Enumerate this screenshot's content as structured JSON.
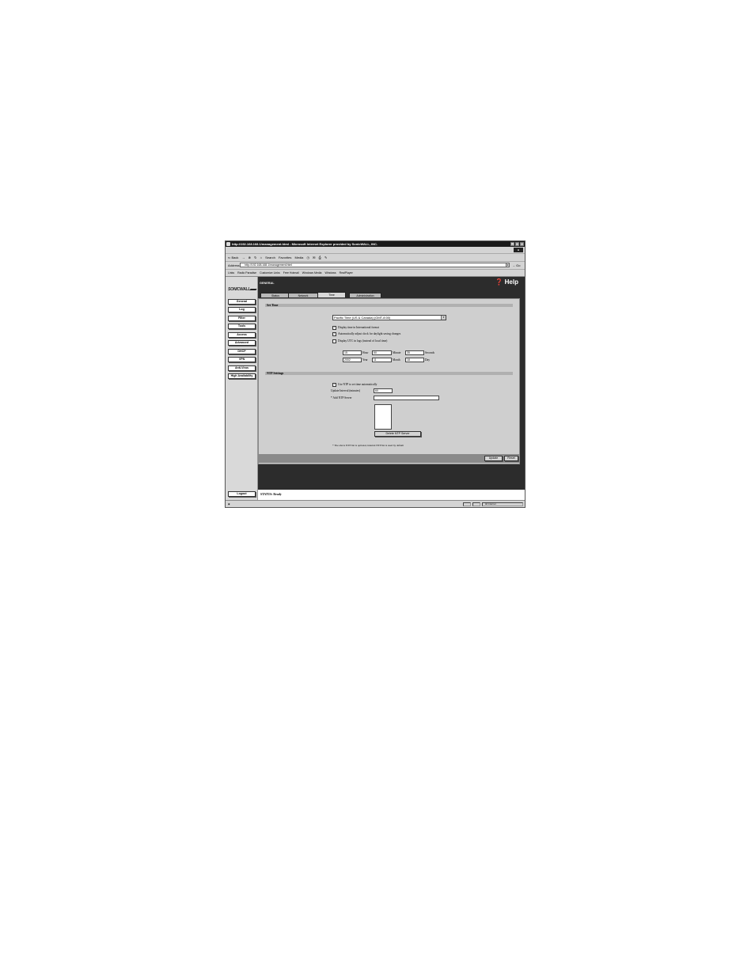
{
  "window": {
    "title": "http://192.168.168.1/management.html - Microsoft Internet Explorer provided by SonicWALL, INC."
  },
  "menu": [
    "File",
    "Edit",
    "View",
    "Favorites",
    "Tools",
    "Help"
  ],
  "toolbar": {
    "back": "⇐ Back",
    "forward": "→",
    "search": "Search",
    "favorites": "Favorites",
    "media": "Media"
  },
  "address": {
    "label": "Address",
    "url": "http://192.168.168.1/management.html",
    "go": "Go"
  },
  "links": {
    "label": "Links",
    "items": [
      "Radio Paradise",
      "Customize Links",
      "Free Hotmail",
      "Windows Media",
      "Windows",
      "RealPlayer"
    ]
  },
  "nav": {
    "brand": "SONICWALL",
    "items": [
      "General",
      "Log",
      "Filter",
      "Tools",
      "Access",
      "Advanced",
      "DHCP",
      "VPN",
      "Anti-Virus",
      "High Availability"
    ],
    "logout": "Logout"
  },
  "page": {
    "header": "GENERAL",
    "help": "Help",
    "tabs": [
      "Status",
      "Network",
      "Time",
      "Administration"
    ],
    "active_tab": "Time"
  },
  "set_time": {
    "title": "Set Time",
    "timezone": "Pacific Time (US & Canada) (GMT-8:00)",
    "opt_international": "Display time in International format",
    "opt_daylight": "Automatically adjust clock for daylight saving changes",
    "opt_utc": "Display UTC in logs (instead of local time)",
    "hour": "15",
    "hour_label": "Hour",
    "minute": "50",
    "minute_label": "Minute",
    "second": "35",
    "second_label": "Seconds",
    "year": "2002",
    "year_label": "Year",
    "month": "11",
    "month_label": "Month",
    "day": "18",
    "day_label": "Day"
  },
  "ntp": {
    "title": "NTP Settings",
    "opt_use_ntp": "Use NTP to set time automatically",
    "interval_label": "Update Interval (minutes)",
    "interval": "60",
    "add_label": "* Add NTP Server",
    "add_value": "",
    "delete_button": "Delete NTP Server",
    "note": "* The above NTP list is optional, internal NTP list is used by default"
  },
  "actions": {
    "update": "Update",
    "reset": "Reset"
  },
  "status": {
    "text": "STATUS: Ready"
  },
  "statusbar": {
    "zone": "Internet"
  }
}
